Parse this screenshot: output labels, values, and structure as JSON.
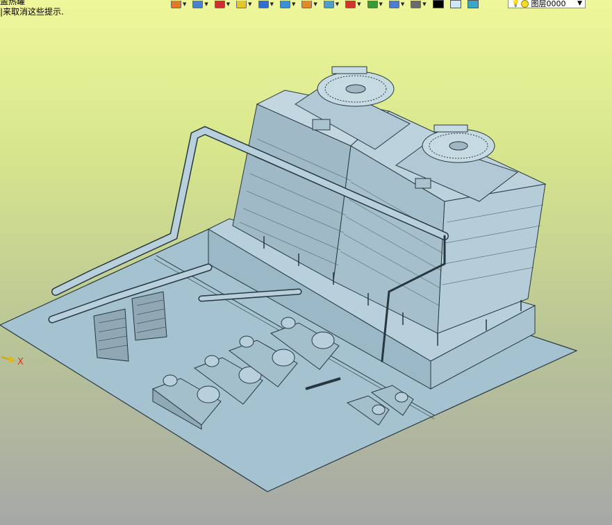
{
  "prompt": {
    "line1": "盖热罐",
    "line2": "|来取消这些提示."
  },
  "toolbar": {
    "buttons": [
      {
        "name": "undo-icon",
        "color": "#e07a24"
      },
      {
        "name": "layers-stack-icon",
        "color": "#4a7fd0"
      },
      {
        "name": "pen-icon",
        "color": "#d02f2f"
      },
      {
        "name": "box-yellow-icon",
        "color": "#e6c72a"
      },
      {
        "name": "box-blue-icon",
        "color": "#2f6fd0"
      },
      {
        "name": "cube-view-icon",
        "color": "#3a8fd6"
      },
      {
        "name": "render-icon",
        "color": "#e28a2a"
      },
      {
        "name": "image-icon",
        "color": "#4aa0c9"
      },
      {
        "name": "snap-target-icon",
        "color": "#d0352f"
      },
      {
        "name": "copy-icon",
        "color": "#3a9a3a"
      },
      {
        "name": "frame-icon",
        "color": "#4a7fd0"
      },
      {
        "name": "database-icon",
        "color": "#6a6a6a"
      }
    ],
    "color_swatch_black": "#000000",
    "color_swatch_blue": "#cfe6ff",
    "layer_stack_color": "#3aa7c9"
  },
  "layer": {
    "label": "图层0000"
  },
  "axis": {
    "x_label": "X"
  },
  "colors": {
    "model_fill": "#a9c7d5",
    "model_edge": "#2d3d45",
    "floor_fill": "#a4c2d0"
  }
}
